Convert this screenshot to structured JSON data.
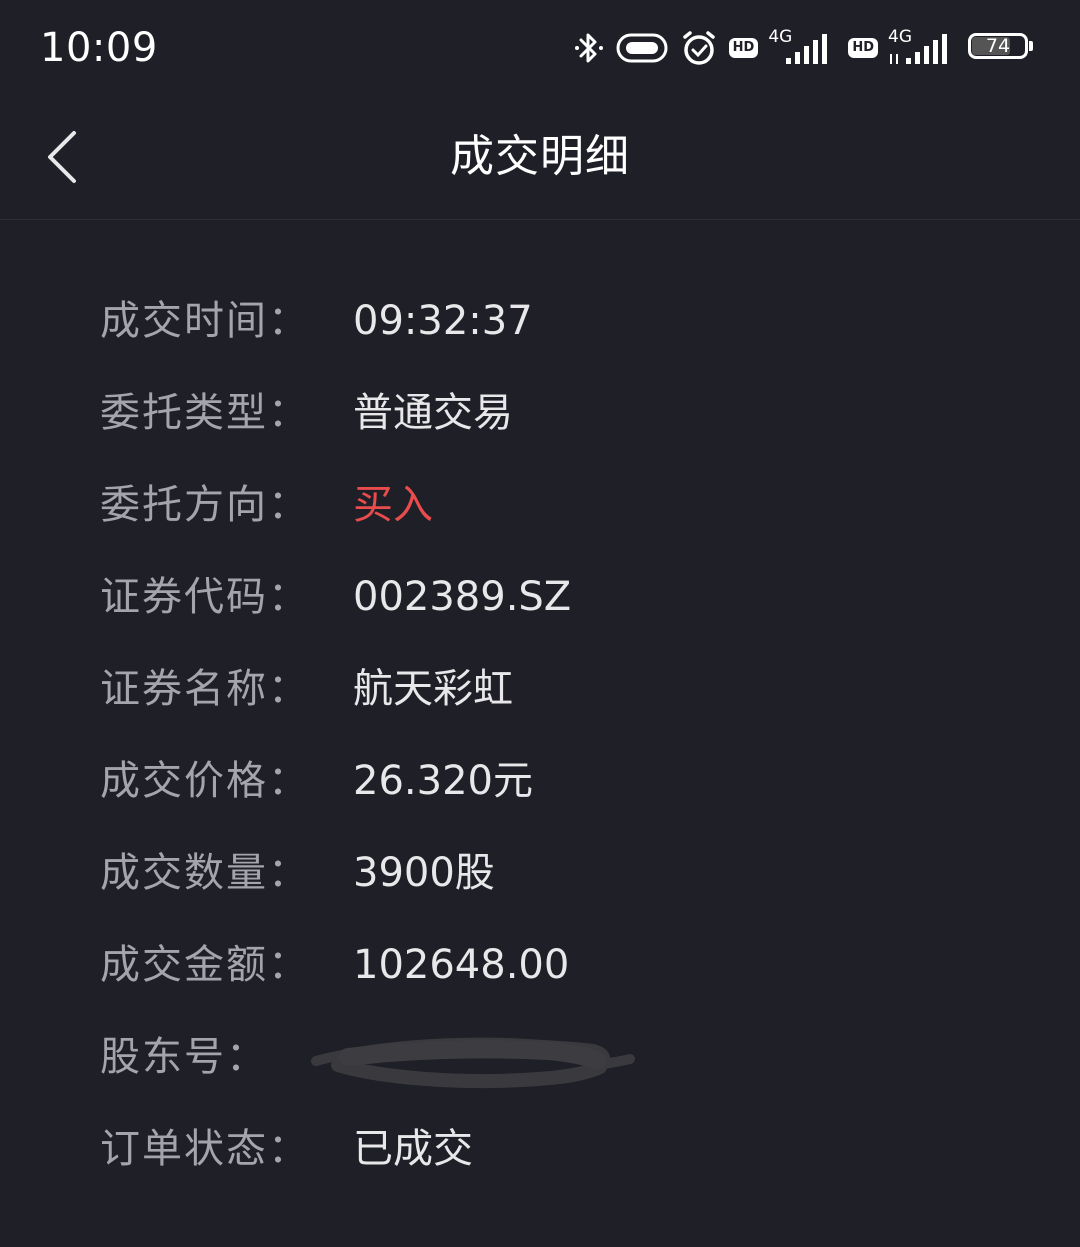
{
  "status_bar": {
    "time": "10:09",
    "icons": [
      "bluetooth-icon",
      "vibrate-icon",
      "alarm-icon",
      "hd-badge",
      "signal-4g-icon",
      "hd-badge",
      "signal-4g-icon",
      "battery-icon"
    ],
    "hd_label": "HD",
    "net_label_1": "4G",
    "net_label_2": "4G",
    "battery_level": "74",
    "battery_level_fraction": 0.74
  },
  "nav": {
    "back_icon": "chevron-left-icon",
    "title": "成交明细"
  },
  "details": [
    {
      "label": "成交时间：",
      "value": "09:32:37"
    },
    {
      "label": "委托类型：",
      "value": "普通交易"
    },
    {
      "label": "委托方向：",
      "value": "买入"
    },
    {
      "label": "证券代码：",
      "value": "002389.SZ"
    },
    {
      "label": "证券名称：",
      "value": "航天彩虹"
    },
    {
      "label": "成交价格：",
      "value": "26.320元"
    },
    {
      "label": "成交数量：",
      "value": "3900股"
    },
    {
      "label": "成交金额：",
      "value": "102648.00"
    },
    {
      "label": "股东号：",
      "value": ""
    },
    {
      "label": "订单状态：",
      "value": "已成交"
    }
  ],
  "colors": {
    "background": "#1f1f27",
    "label": "#a4a4ab",
    "value": "#e8e8ea",
    "buy": "#e84c4c"
  }
}
